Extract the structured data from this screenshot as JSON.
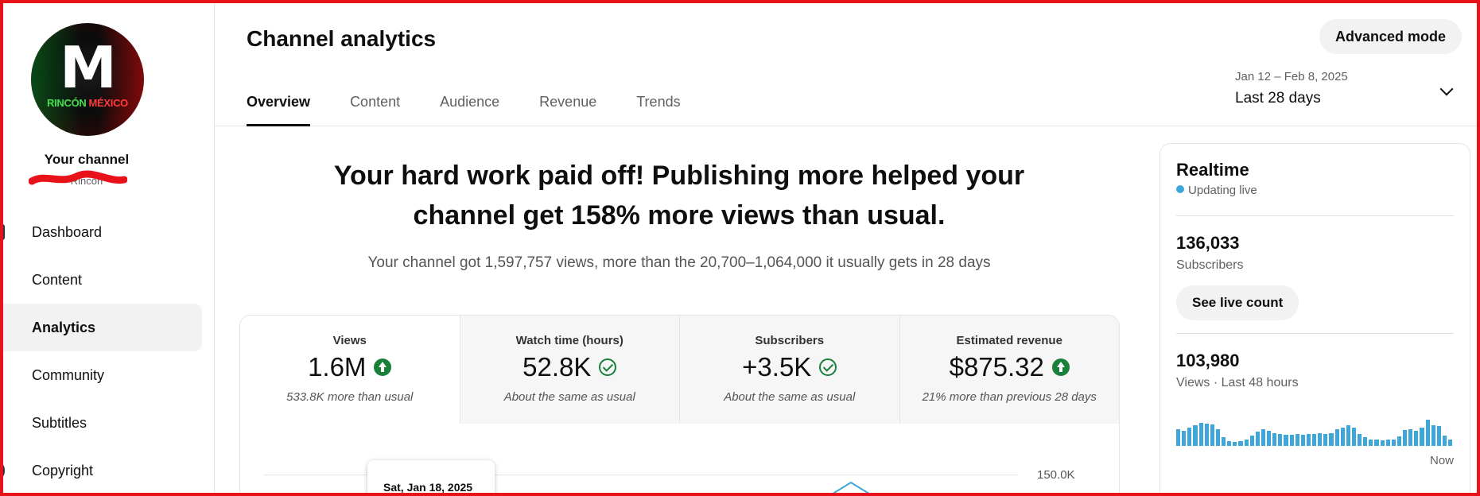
{
  "sidebar": {
    "avatar_initial": "M",
    "avatar_text_1": "RINCÓN",
    "avatar_text_2": "MÉXICO",
    "your_channel": "Your channel",
    "channel_name": "Rincón",
    "items": [
      {
        "label": "Dashboard",
        "icon": "dashboard-icon"
      },
      {
        "label": "Content",
        "icon": "content-icon"
      },
      {
        "label": "Analytics",
        "icon": "analytics-icon",
        "active": true
      },
      {
        "label": "Community",
        "icon": "community-icon"
      },
      {
        "label": "Subtitles",
        "icon": "subtitles-icon"
      },
      {
        "label": "Copyright",
        "icon": "copyright-icon"
      }
    ]
  },
  "header": {
    "title": "Channel analytics",
    "advanced_mode": "Advanced mode",
    "tabs": [
      {
        "label": "Overview",
        "active": true
      },
      {
        "label": "Content"
      },
      {
        "label": "Audience"
      },
      {
        "label": "Revenue"
      },
      {
        "label": "Trends"
      }
    ],
    "date_range_small": "Jan 12 – Feb 8, 2025",
    "date_range": "Last 28 days"
  },
  "summary": {
    "headline": "Your hard work paid off! Publishing more helped your channel get 158% more views than usual.",
    "subline": "Your channel got 1,597,757 views, more than the 20,700–1,064,000 it usually gets in 28 days"
  },
  "metrics": [
    {
      "label": "Views",
      "value": "1.6M",
      "status": "up",
      "note": "533.8K more than usual"
    },
    {
      "label": "Watch time (hours)",
      "value": "52.8K",
      "status": "ok",
      "note": "About the same as usual"
    },
    {
      "label": "Subscribers",
      "value": "+3.5K",
      "status": "ok",
      "note": "About the same as usual"
    },
    {
      "label": "Estimated revenue",
      "value": "$875.32",
      "status": "up",
      "note": "21% more than previous 28 days"
    }
  ],
  "chart": {
    "y_max_label": "150.0K",
    "tooltip_date": "Sat, Jan 18, 2025"
  },
  "realtime": {
    "title": "Realtime",
    "live": "Updating live",
    "subscribers": "136,033",
    "subscribers_label": "Subscribers",
    "see_live": "See live count",
    "views": "103,980",
    "views_label": "Views · Last 48 hours",
    "now": "Now",
    "bar_values": [
      0.5,
      0.45,
      0.55,
      0.62,
      0.7,
      0.66,
      0.64,
      0.5,
      0.25,
      0.15,
      0.12,
      0.14,
      0.2,
      0.3,
      0.42,
      0.5,
      0.45,
      0.38,
      0.36,
      0.34,
      0.33,
      0.35,
      0.34,
      0.36,
      0.35,
      0.37,
      0.36,
      0.38,
      0.5,
      0.55,
      0.62,
      0.55,
      0.35,
      0.25,
      0.2,
      0.18,
      0.16,
      0.18,
      0.2,
      0.28,
      0.48,
      0.5,
      0.46,
      0.55,
      0.78,
      0.62,
      0.6,
      0.3,
      0.2
    ],
    "accent": "#3ea6d9"
  }
}
